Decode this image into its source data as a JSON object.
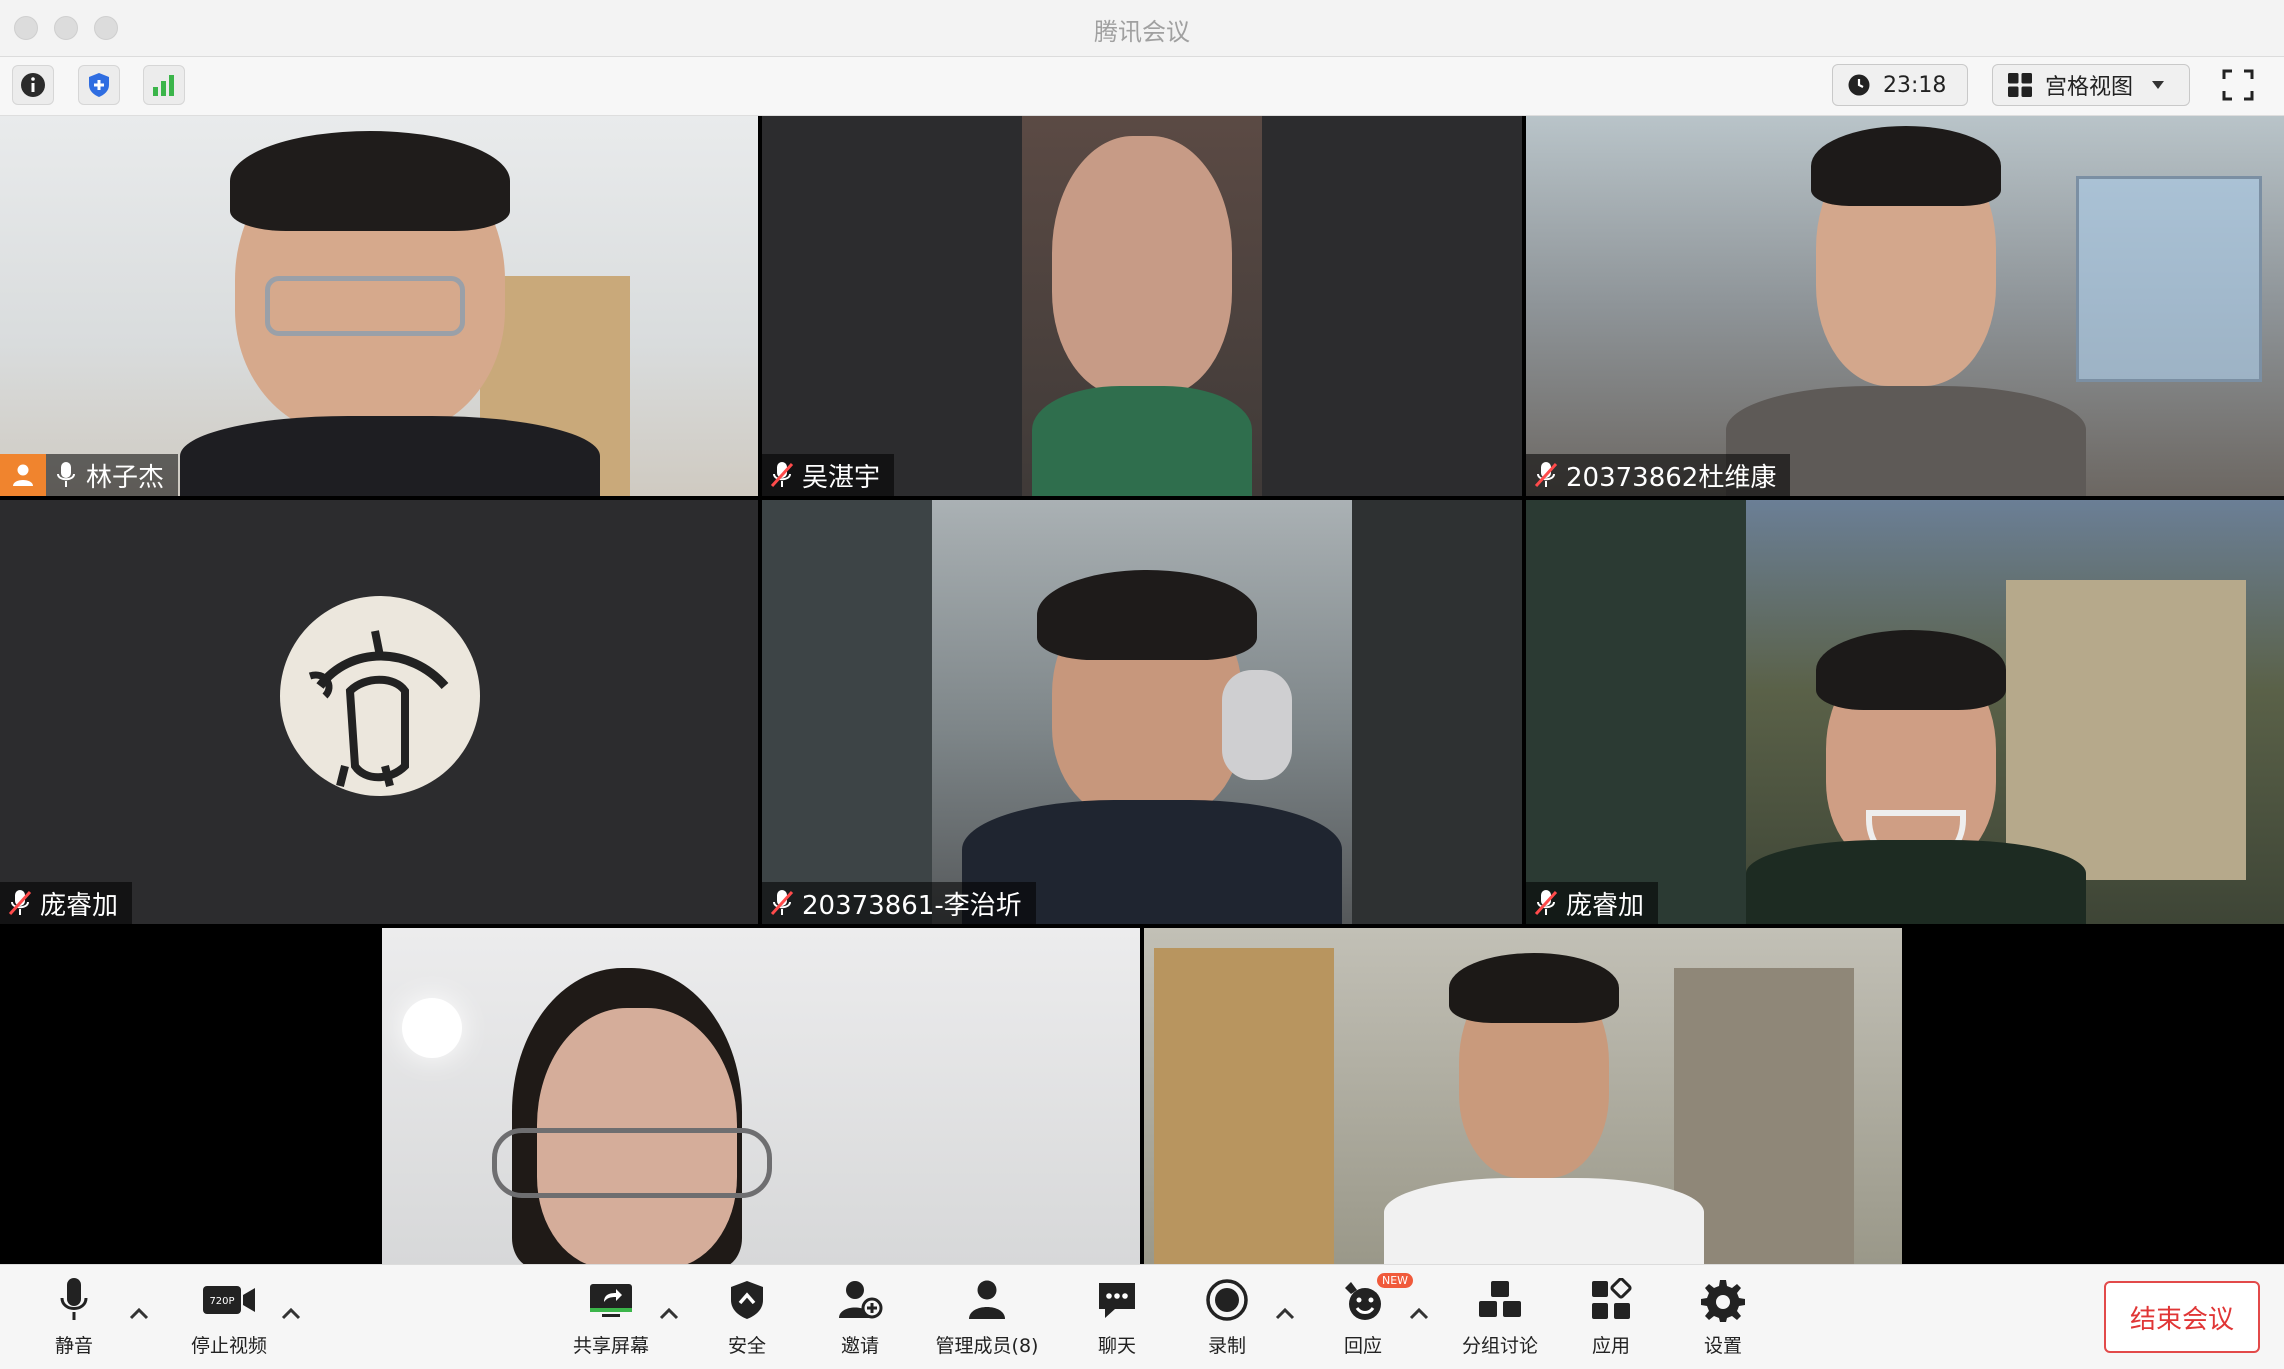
{
  "window": {
    "title": "腾讯会议"
  },
  "topbar": {
    "timer": "23:18",
    "view_mode": "宫格视图"
  },
  "participants": [
    {
      "name": "林子杰",
      "mic": "on",
      "host": true
    },
    {
      "name": "吴湛宇",
      "mic": "muted"
    },
    {
      "name": "20373862杜维康",
      "mic": "muted"
    },
    {
      "name": "庞睿加",
      "mic": "muted",
      "video": "off"
    },
    {
      "name": "20373861-李治圻",
      "mic": "muted"
    },
    {
      "name": "庞睿加",
      "mic": "muted"
    },
    {
      "name": "",
      "mic": "unknown"
    },
    {
      "name": "",
      "mic": "unknown"
    }
  ],
  "toolbar": {
    "mute": "静音",
    "stop_video": "停止视频",
    "video_quality": "720P",
    "share_screen": "共享屏幕",
    "security": "安全",
    "invite": "邀请",
    "manage_members": "管理成员(8)",
    "chat": "聊天",
    "record": "录制",
    "reactions": "回应",
    "reactions_badge": "NEW",
    "breakout": "分组讨论",
    "apps": "应用",
    "settings": "设置",
    "end_meeting": "结束会议"
  },
  "colors": {
    "host_badge": "#f0842e",
    "end_button": "#e03636",
    "security_badge": "#2f6de1",
    "signal_bars": "#3bb54a",
    "new_badge": "#f05a3b"
  }
}
